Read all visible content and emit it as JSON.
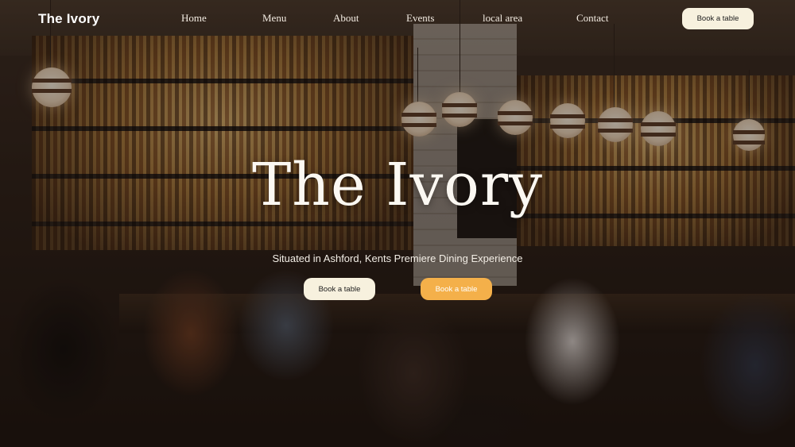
{
  "brand": {
    "name": "The Ivory"
  },
  "nav": {
    "links": [
      "Home",
      "Menu",
      "About",
      "Events",
      "local area",
      "Contact"
    ],
    "cta_label": "Book a table"
  },
  "hero": {
    "title": "The Ivory",
    "subtitle": "Situated in Ashford, Kents Premiere Dining Experience",
    "primary_cta": "Book a table",
    "secondary_cta": "Book a table"
  },
  "colors": {
    "cta_light": "#f7f1de",
    "cta_accent": "#f4b04a"
  }
}
